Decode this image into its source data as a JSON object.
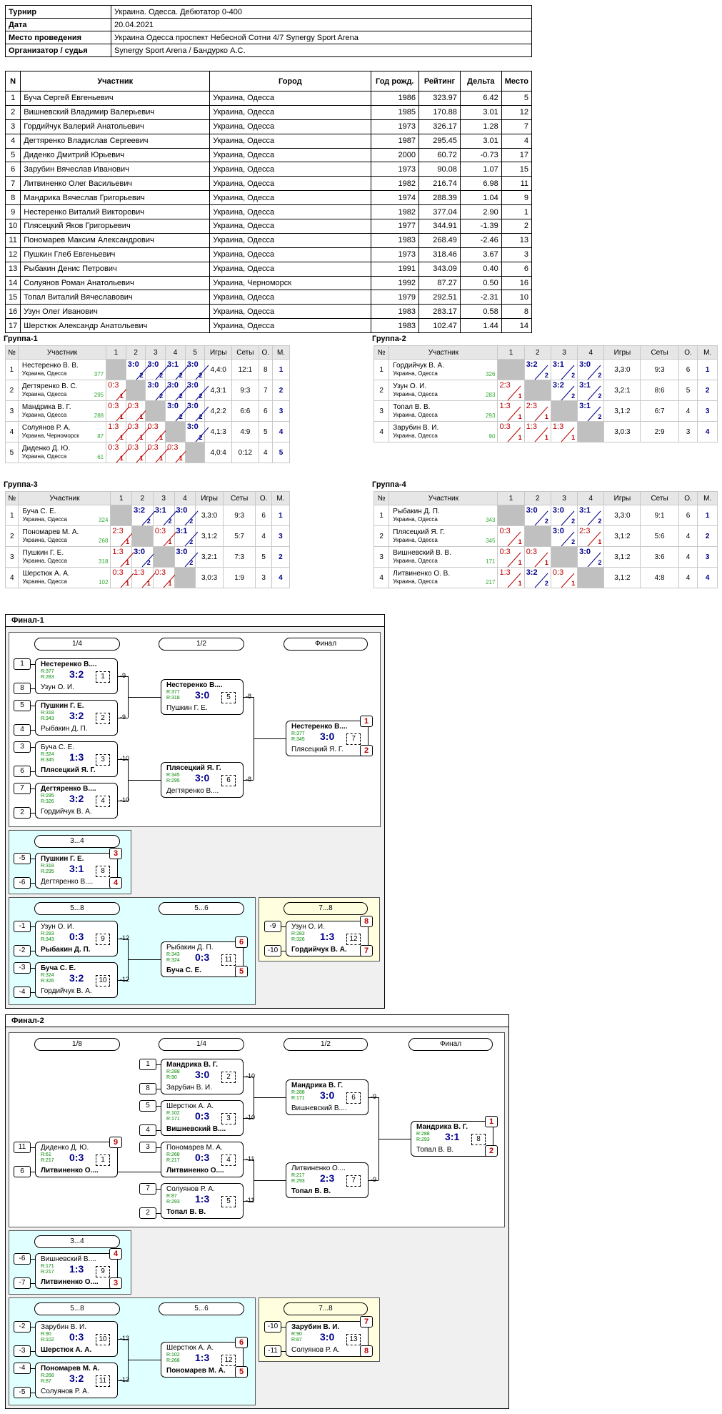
{
  "info": {
    "rows": [
      [
        "Турнир",
        "Украина. Одесса. Дебютатор 0-400"
      ],
      [
        "Дата",
        "20.04.2021"
      ],
      [
        "Место проведения",
        "Украина Одесса проспект Небесной Сотни 4/7 Synergy Sport Arena"
      ],
      [
        "Организатор / судья",
        "Synergy Sport Arena / Бандурко А.С."
      ]
    ]
  },
  "players": {
    "headers": [
      "N",
      "Участник",
      "Город",
      "Год рожд.",
      "Рейтинг",
      "Дельта",
      "Место"
    ],
    "rows": [
      [
        "1",
        "Буча Сергей Евгеньевич",
        "Украина, Одесса",
        "1986",
        "323.97",
        "6.42",
        "5"
      ],
      [
        "2",
        "Вишневский Владимир Валерьевич",
        "Украина, Одесса",
        "1985",
        "170.88",
        "3.01",
        "12"
      ],
      [
        "3",
        "Гордийчук Валерий Анатольевич",
        "Украина, Одесса",
        "1973",
        "326.17",
        "1.28",
        "7"
      ],
      [
        "4",
        "Дегтяренко Владислав Сергеевич",
        "Украина, Одесса",
        "1987",
        "295.45",
        "3.01",
        "4"
      ],
      [
        "5",
        "Диденко Дмитрий Юрьевич",
        "Украина, Одесса",
        "2000",
        "60.72",
        "-0.73",
        "17"
      ],
      [
        "6",
        "Зарубин Вячеслав Иванович",
        "Украина, Одесса",
        "1973",
        "90.08",
        "1.07",
        "15"
      ],
      [
        "7",
        "Литвиненко Олег Васильевич",
        "Украина, Одесса",
        "1982",
        "216.74",
        "6.98",
        "11"
      ],
      [
        "8",
        "Мандрика Вячеслав Григорьевич",
        "Украина, Одесса",
        "1974",
        "288.39",
        "1.04",
        "9"
      ],
      [
        "9",
        "Нестеренко Виталий Викторович",
        "Украина, Одесса",
        "1982",
        "377.04",
        "2.90",
        "1"
      ],
      [
        "10",
        "Плясецкий Яков Григорьевич",
        "Украина, Одесса",
        "1977",
        "344.91",
        "-1.39",
        "2"
      ],
      [
        "11",
        "Пономарев Максим Александрович",
        "Украина, Одесса",
        "1983",
        "268.49",
        "-2.46",
        "13"
      ],
      [
        "12",
        "Пушкин Глеб Евгеньевич",
        "Украина, Одесса",
        "1973",
        "318.46",
        "3.67",
        "3"
      ],
      [
        "13",
        "Рыбакин Денис Петрович",
        "Украина, Одесса",
        "1991",
        "343.09",
        "0.40",
        "6"
      ],
      [
        "14",
        "Солуянов Роман Анатольевич",
        "Украина, Черноморск",
        "1992",
        "87.27",
        "0.50",
        "16"
      ],
      [
        "15",
        "Топал Виталий Вячеславович",
        "Украина, Одесса",
        "1979",
        "292.51",
        "-2.31",
        "10"
      ],
      [
        "16",
        "Узун Олег Иванович",
        "Украина, Одесса",
        "1983",
        "283.17",
        "0.58",
        "8"
      ],
      [
        "17",
        "Шерстюк Александр Анатольевич",
        "Украина, Одесса",
        "1983",
        "102.47",
        "1.44",
        "14"
      ]
    ]
  },
  "groups": [
    {
      "title": "Группа-1",
      "headers": [
        "№",
        "Участник",
        "1",
        "2",
        "3",
        "4",
        "5",
        "Игры",
        "Сеты",
        "О.",
        "М."
      ],
      "rows": [
        {
          "n": "1",
          "name": "Нестеренко В. В.",
          "city": "Украина, Одесса",
          "rating": "377",
          "cells": [
            "x",
            [
              "3:0",
              "2"
            ],
            [
              "3:0",
              "2"
            ],
            [
              "3:1",
              "2"
            ],
            [
              "3:0",
              "2"
            ]
          ],
          "games": "4,4:0",
          "sets": "12:1",
          "pts": "8",
          "place": "1"
        },
        {
          "n": "2",
          "name": "Дегтяренко В. С.",
          "city": "Украина, Одесса",
          "rating": "295",
          "cells": [
            [
              "0:3",
              "1"
            ],
            "x",
            [
              "3:0",
              "2"
            ],
            [
              "3:0",
              "2"
            ],
            [
              "3:0",
              "2"
            ]
          ],
          "games": "4,3:1",
          "sets": "9:3",
          "pts": "7",
          "place": "2"
        },
        {
          "n": "3",
          "name": "Мандрика В. Г.",
          "city": "Украина, Одесса",
          "rating": "288",
          "cells": [
            [
              "0:3",
              "1"
            ],
            [
              "0:3",
              "1"
            ],
            "x",
            [
              "3:0",
              "2"
            ],
            [
              "3:0",
              "2"
            ]
          ],
          "games": "4,2:2",
          "sets": "6:6",
          "pts": "6",
          "place": "3"
        },
        {
          "n": "4",
          "name": "Солуянов Р. А.",
          "city": "Украина, Черноморск",
          "rating": "87",
          "cells": [
            [
              "1:3",
              "1"
            ],
            [
              "0:3",
              "1"
            ],
            [
              "0:3",
              "1"
            ],
            "x",
            [
              "3:0",
              "2"
            ]
          ],
          "games": "4,1:3",
          "sets": "4:9",
          "pts": "5",
          "place": "4"
        },
        {
          "n": "5",
          "name": "Диденко Д. Ю.",
          "city": "Украина, Одесса",
          "rating": "61",
          "cells": [
            [
              "0:3",
              "1"
            ],
            [
              "0:3",
              "1"
            ],
            [
              "0:3",
              "1"
            ],
            [
              "0:3",
              "1"
            ],
            "x"
          ],
          "games": "4,0:4",
          "sets": "0:12",
          "pts": "4",
          "place": "5"
        }
      ]
    },
    {
      "title": "Группа-2",
      "headers": [
        "№",
        "Участник",
        "1",
        "2",
        "3",
        "4",
        "Игры",
        "Сеты",
        "О.",
        "М."
      ],
      "rows": [
        {
          "n": "1",
          "name": "Гордийчук В. А.",
          "city": "Украина, Одесса",
          "rating": "326",
          "cells": [
            "x",
            [
              "3:2",
              "2"
            ],
            [
              "3:1",
              "2"
            ],
            [
              "3:0",
              "2"
            ]
          ],
          "games": "3,3:0",
          "sets": "9:3",
          "pts": "6",
          "place": "1"
        },
        {
          "n": "2",
          "name": "Узун О. И.",
          "city": "Украина, Одесса",
          "rating": "283",
          "cells": [
            [
              "2:3",
              "1"
            ],
            "x",
            [
              "3:2",
              "2"
            ],
            [
              "3:1",
              "2"
            ]
          ],
          "games": "3,2:1",
          "sets": "8:6",
          "pts": "5",
          "place": "2"
        },
        {
          "n": "3",
          "name": "Топал В. В.",
          "city": "Украина, Одесса",
          "rating": "293",
          "cells": [
            [
              "1:3",
              "1"
            ],
            [
              "2:3",
              "1"
            ],
            "x",
            [
              "3:1",
              "2"
            ]
          ],
          "games": "3,1:2",
          "sets": "6:7",
          "pts": "4",
          "place": "3"
        },
        {
          "n": "4",
          "name": "Зарубин В. И.",
          "city": "Украина, Одесса",
          "rating": "90",
          "cells": [
            [
              "0:3",
              "1"
            ],
            [
              "1:3",
              "1"
            ],
            [
              "1:3",
              "1"
            ],
            "x"
          ],
          "games": "3,0:3",
          "sets": "2:9",
          "pts": "3",
          "place": "4"
        }
      ]
    },
    {
      "title": "Группа-3",
      "headers": [
        "№",
        "Участник",
        "1",
        "2",
        "3",
        "4",
        "Игры",
        "Сеты",
        "О.",
        "М."
      ],
      "rows": [
        {
          "n": "1",
          "name": "Буча С. Е.",
          "city": "Украина, Одесса",
          "rating": "324",
          "cells": [
            "x",
            [
              "3:2",
              "2"
            ],
            [
              "3:1",
              "2"
            ],
            [
              "3:0",
              "2"
            ]
          ],
          "games": "3,3:0",
          "sets": "9:3",
          "pts": "6",
          "place": "1"
        },
        {
          "n": "2",
          "name": "Пономарев М. А.",
          "city": "Украина, Одесса",
          "rating": "268",
          "cells": [
            [
              "2:3",
              "1"
            ],
            "x",
            [
              "0:3",
              "1"
            ],
            [
              "3:1",
              "2"
            ]
          ],
          "games": "3,1:2",
          "sets": "5:7",
          "pts": "4",
          "place": "3"
        },
        {
          "n": "3",
          "name": "Пушкин Г. Е.",
          "city": "Украина, Одесса",
          "rating": "318",
          "cells": [
            [
              "1:3",
              "1"
            ],
            [
              "3:0",
              "2"
            ],
            "x",
            [
              "3:0",
              "2"
            ]
          ],
          "games": "3,2:1",
          "sets": "7:3",
          "pts": "5",
          "place": "2"
        },
        {
          "n": "4",
          "name": "Шерстюк А. А.",
          "city": "Украина, Одесса",
          "rating": "102",
          "cells": [
            [
              "0:3",
              "1"
            ],
            [
              "1:3",
              "1"
            ],
            [
              "0:3",
              "1"
            ],
            "x"
          ],
          "games": "3,0:3",
          "sets": "1:9",
          "pts": "3",
          "place": "4"
        }
      ]
    },
    {
      "title": "Группа-4",
      "headers": [
        "№",
        "Участник",
        "1",
        "2",
        "3",
        "4",
        "Игры",
        "Сеты",
        "О.",
        "М."
      ],
      "rows": [
        {
          "n": "1",
          "name": "Рыбакин Д. П.",
          "city": "Украина, Одесса",
          "rating": "343",
          "cells": [
            "x",
            [
              "3:0",
              "2"
            ],
            [
              "3:0",
              "2"
            ],
            [
              "3:1",
              "2"
            ]
          ],
          "games": "3,3:0",
          "sets": "9:1",
          "pts": "6",
          "place": "1"
        },
        {
          "n": "2",
          "name": "Плясецкий Я. Г.",
          "city": "Украина, Одесса",
          "rating": "345",
          "cells": [
            [
              "0:3",
              "1"
            ],
            "x",
            [
              "3:0",
              "2"
            ],
            [
              "2:3",
              "1"
            ]
          ],
          "games": "3,1:2",
          "sets": "5:6",
          "pts": "4",
          "place": "2"
        },
        {
          "n": "3",
          "name": "Вишневский В. В.",
          "city": "Украина, Одесса",
          "rating": "171",
          "cells": [
            [
              "0:3",
              "1"
            ],
            [
              "0:3",
              "1"
            ],
            "x",
            [
              "3:0",
              "2"
            ]
          ],
          "games": "3,1:2",
          "sets": "3:6",
          "pts": "4",
          "place": "3"
        },
        {
          "n": "4",
          "name": "Литвиненко О. В.",
          "city": "Украина, Одесса",
          "rating": "217",
          "cells": [
            [
              "1:3",
              "1"
            ],
            [
              "3:2",
              "2"
            ],
            [
              "0:3",
              "1"
            ],
            "x"
          ],
          "games": "3,1:2",
          "sets": "4:8",
          "pts": "4",
          "place": "4"
        }
      ]
    }
  ],
  "final1": {
    "title": "Финал-1",
    "rounds": [
      "1/4",
      "1/2",
      "Финал"
    ],
    "r34": "3...4",
    "r58": "5...8",
    "r56": "5...6",
    "r78": "7...8",
    "matches": [
      {
        "p1": "Нестеренко В....",
        "r1": "R:377",
        "p2": "Узун О. И.",
        "r2": "R:283",
        "score": "3:2",
        "num": "1",
        "w": 1,
        "s1": "1",
        "s2": "8",
        "next": "-9"
      },
      {
        "p1": "Пушкин Г. Е.",
        "r1": "R:318",
        "p2": "Рыбакин Д. П.",
        "r2": "R:343",
        "score": "3:2",
        "num": "2",
        "w": 1,
        "s1": "5",
        "s2": "4",
        "next": "-9"
      },
      {
        "p1": "Буча С. Е.",
        "r1": "R:324",
        "p2": "Плясецкий Я. Г.",
        "r2": "R:345",
        "score": "1:3",
        "num": "3",
        "w": 2,
        "s1": "3",
        "s2": "6",
        "next": "-10"
      },
      {
        "p1": "Дегтяренко В....",
        "r1": "R:295",
        "p2": "Гордийчук В. А.",
        "r2": "R:326",
        "score": "3:2",
        "num": "4",
        "w": 1,
        "s1": "7",
        "s2": "2",
        "next": "-10"
      },
      {
        "p1": "Нестеренко В....",
        "r1": "R:377",
        "p2": "Пушкин Г. Е.",
        "r2": "R:318",
        "score": "3:0",
        "num": "5",
        "w": 1,
        "next": "-8"
      },
      {
        "p1": "Плясецкий Я. Г.",
        "r1": "R:345",
        "p2": "Дегтяренко В....",
        "r2": "R:295",
        "score": "3:0",
        "num": "6",
        "w": 1,
        "next": "-8"
      },
      {
        "p1": "Нестеренко В....",
        "r1": "R:377",
        "p2": "Плясецкий Я. Г.",
        "r2": "R:345",
        "score": "3:0",
        "num": "7",
        "w": 1,
        "pl1": "1",
        "pl2": "2"
      },
      {
        "p1": "Пушкин Г. Е.",
        "r1": "R:318",
        "p2": "Дегтяренко В....",
        "r2": "R:295",
        "score": "3:1",
        "num": "8",
        "w": 1,
        "s1": "-5",
        "s2": "-6",
        "pl1": "3",
        "pl2": "4"
      },
      {
        "p1": "Узун О. И.",
        "r1": "R:283",
        "p2": "Рыбакин Д. П.",
        "r2": "R:343",
        "score": "0:3",
        "num": "9",
        "w": 2,
        "s1": "-1",
        "s2": "-2",
        "next": "-12"
      },
      {
        "p1": "Буча С. Е.",
        "r1": "R:324",
        "p2": "Гордийчук В. А.",
        "r2": "R:326",
        "score": "3:2",
        "num": "10",
        "w": 1,
        "s1": "-3",
        "s2": "-4",
        "next": "-12"
      },
      {
        "p1": "Рыбакин Д. П.",
        "r1": "R:343",
        "p2": "Буча С. Е.",
        "r2": "R:324",
        "score": "0:3",
        "num": "11",
        "w": 2,
        "pl1": "6",
        "pl2": "5"
      },
      {
        "p1": "Узун О. И.",
        "r1": "R:283",
        "p2": "Гордийчук В. А.",
        "r2": "R:326",
        "score": "1:3",
        "num": "12",
        "w": 2,
        "s1": "-9",
        "s2": "-10",
        "pl1": "8",
        "pl2": "7"
      }
    ]
  },
  "final2": {
    "title": "Финал-2",
    "rounds": [
      "1/8",
      "1/4",
      "1/2",
      "Финал"
    ],
    "r34": "3...4",
    "r58": "5...8",
    "r56": "5...6",
    "r78": "7...8",
    "matches": [
      {
        "p1": "Мандрика В. Г.",
        "r1": "R:288",
        "p2": "Зарубин В. И.",
        "r2": "R:90",
        "score": "3:0",
        "num": "2",
        "w": 1,
        "s1": "1",
        "s2": "8",
        "next": "-10"
      },
      {
        "p1": "Шерстюк А. А.",
        "r1": "R:102",
        "p2": "Вишневский В....",
        "r2": "R:171",
        "score": "0:3",
        "num": "3",
        "w": 2,
        "s1": "5",
        "s2": "4",
        "next": "-10"
      },
      {
        "p1": "Диденко Д. Ю.",
        "r1": "R:61",
        "p2": "Литвиненко О....",
        "r2": "R:217",
        "score": "0:3",
        "num": "1",
        "w": 2,
        "s1": "11",
        "s2": "6",
        "pl1": "9",
        "next": ""
      },
      {
        "p1": "Пономарев М. А.",
        "r1": "R:268",
        "p2": "Литвиненко О....",
        "r2": "R:217",
        "score": "0:3",
        "num": "4",
        "w": 2,
        "s1": "3",
        "next": "-11"
      },
      {
        "p1": "Солуянов Р. А.",
        "r1": "R:87",
        "p2": "Топал В. В.",
        "r2": "R:293",
        "score": "1:3",
        "num": "5",
        "w": 2,
        "s1": "7",
        "s2": "2",
        "next": "-11"
      },
      {
        "p1": "Мандрика В. Г.",
        "r1": "R:288",
        "p2": "Вишневский В....",
        "r2": "R:171",
        "score": "3:0",
        "num": "6",
        "w": 1,
        "next": "-9"
      },
      {
        "p1": "Литвиненко О....",
        "r1": "R:217",
        "p2": "Топал В. В.",
        "r2": "R:293",
        "score": "2:3",
        "num": "7",
        "w": 2,
        "next": "-9"
      },
      {
        "p1": "Мандрика В. Г.",
        "r1": "R:288",
        "p2": "Топал В. В.",
        "r2": "R:293",
        "score": "3:1",
        "num": "8",
        "w": 1,
        "pl1": "1",
        "pl2": "2"
      },
      {
        "p1": "Вишневский В....",
        "r1": "R:171",
        "p2": "Литвиненко О....",
        "r2": "R:217",
        "score": "1:3",
        "num": "9",
        "w": 2,
        "s1": "-6",
        "s2": "-7",
        "pl1": "4",
        "pl2": "3"
      },
      {
        "p1": "Зарубин В. И.",
        "r1": "R:90",
        "p2": "Шерстюк А. А.",
        "r2": "R:102",
        "score": "0:3",
        "num": "10",
        "w": 2,
        "s1": "-2",
        "s2": "-3",
        "next": "-13"
      },
      {
        "p1": "Пономарев М. А.",
        "r1": "R:268",
        "p2": "Солуянов Р. А.",
        "r2": "R:87",
        "score": "3:2",
        "num": "11",
        "w": 1,
        "s1": "-4",
        "s2": "-5",
        "next": "-13"
      },
      {
        "p1": "Шерстюк А. А.",
        "r1": "R:102",
        "p2": "Пономарев М. А.",
        "r2": "R:268",
        "score": "1:3",
        "num": "12",
        "w": 2,
        "pl1": "6",
        "pl2": "5"
      },
      {
        "p1": "Зарубин В. И.",
        "r1": "R:90",
        "p2": "Солуянов Р. А.",
        "r2": "R:87",
        "score": "3:0",
        "num": "13",
        "w": 1,
        "s1": "-10",
        "s2": "-11",
        "pl1": "7",
        "pl2": "8"
      }
    ]
  }
}
